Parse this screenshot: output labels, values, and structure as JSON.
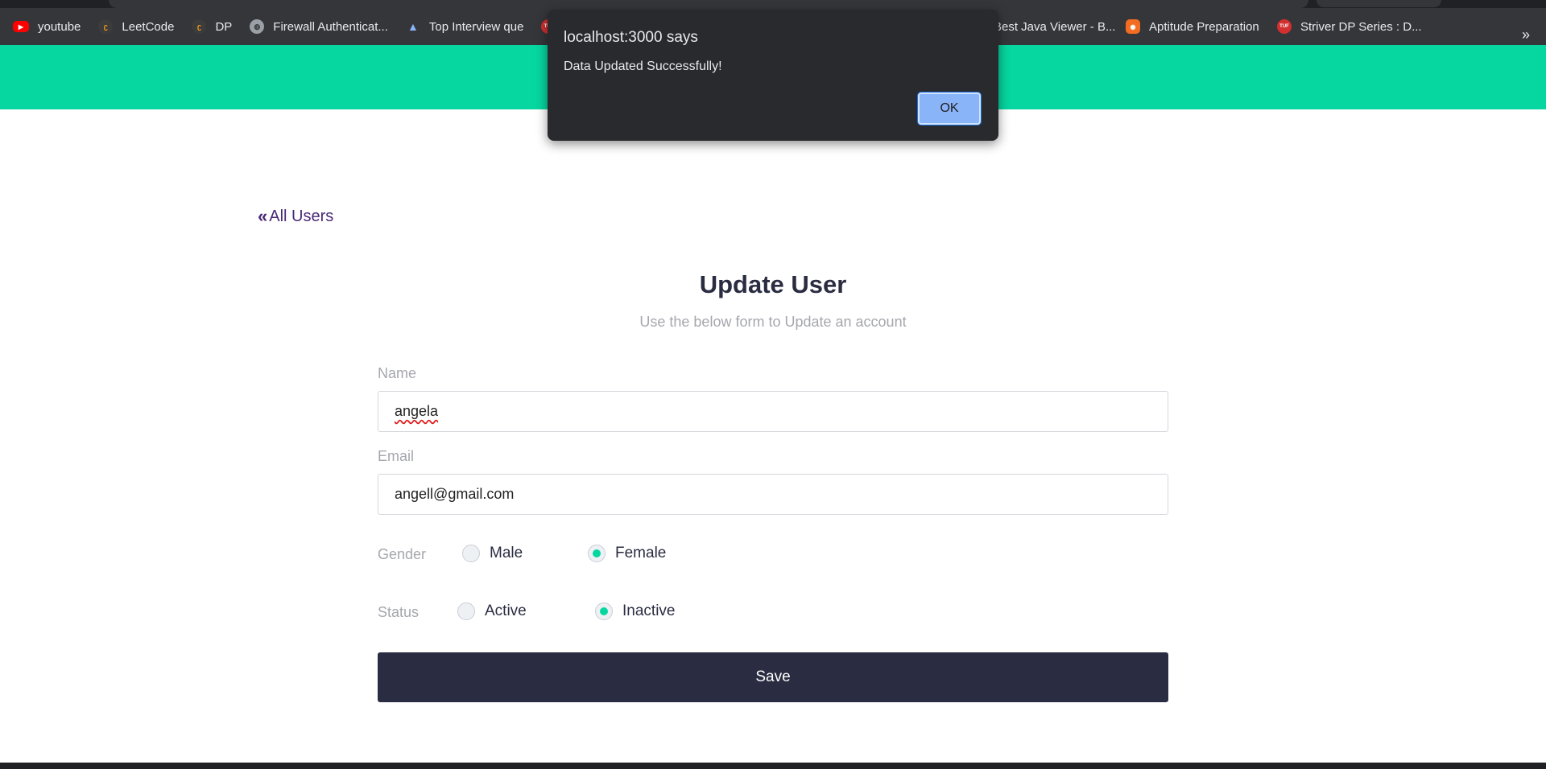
{
  "browser": {
    "bookmarks": [
      {
        "label": "youtube",
        "icon": "youtube-icon",
        "color": "#ff0000"
      },
      {
        "label": "LeetCode",
        "icon": "leetcode-icon",
        "color": "#ffa116"
      },
      {
        "label": "DP",
        "icon": "leetcode-icon",
        "color": "#ffa116"
      },
      {
        "label": "Firewall Authenticat...",
        "icon": "globe-icon",
        "color": "#9aa0a6"
      },
      {
        "label": "Top Interview que",
        "icon": "mountain-icon",
        "color": "#8ab4f8"
      },
      {
        "label": "",
        "icon": "tuf-icon",
        "color": "#d32f2f"
      }
    ],
    "bookmarks_right": [
      {
        "label": "Best Java Viewer - B...",
        "icon": "",
        "color": ""
      },
      {
        "label": "Aptitude Preparation",
        "icon": "ninja-icon",
        "color": "#f26d21"
      },
      {
        "label": "Striver DP Series : D...",
        "icon": "tuf-icon",
        "color": "#d32f2f"
      }
    ],
    "overflow_icon": "»"
  },
  "dialog": {
    "title": "localhost:3000 says",
    "message": "Data Updated Successfully!",
    "ok_label": "OK"
  },
  "page": {
    "back_label": "All Users",
    "back_icon": "«",
    "title": "Update User",
    "subtitle": "Use the below form to Update an account",
    "form": {
      "name_label": "Name",
      "name_value": "angela",
      "email_label": "Email",
      "email_value": "angell@gmail.com",
      "gender_label": "Gender",
      "gender_options": [
        "Male",
        "Female"
      ],
      "gender_selected": "Female",
      "status_label": "Status",
      "status_options": [
        "Active",
        "Inactive"
      ],
      "status_selected": "Inactive",
      "save_label": "Save"
    }
  },
  "colors": {
    "accent": "#06d6a0",
    "button": "#2a2c41",
    "link": "#4a2a78"
  }
}
